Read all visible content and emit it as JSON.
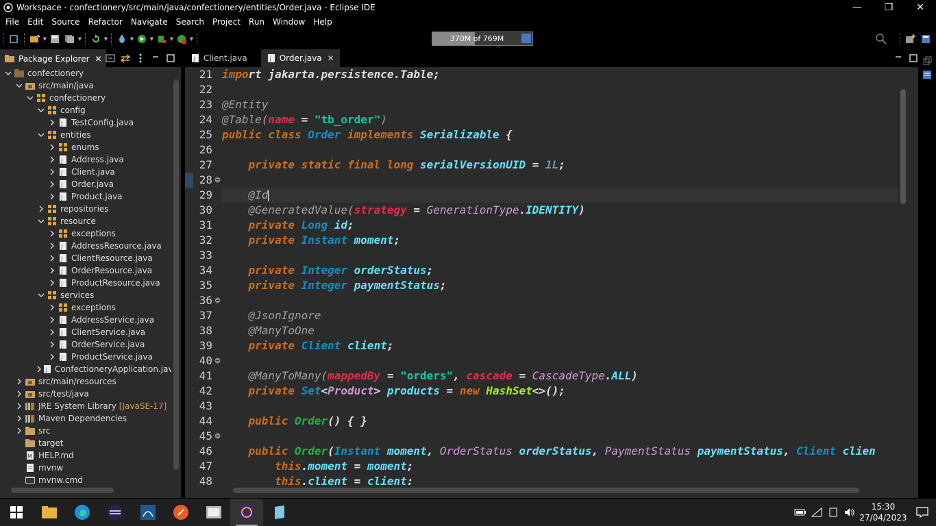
{
  "window": {
    "title": "Workspace - confectionery/src/main/java/confectionery/entities/Order.java - Eclipse IDE",
    "minimize": "—",
    "restore": "❐",
    "close": "✕"
  },
  "menubar": [
    "File",
    "Edit",
    "Source",
    "Refactor",
    "Navigate",
    "Search",
    "Project",
    "Run",
    "Window",
    "Help"
  ],
  "heap": {
    "label": "370M of 769M",
    "used_fraction": 0.48
  },
  "package_explorer": {
    "tab_label": "Package Explorer",
    "close": "✕",
    "tree": [
      {
        "label": "confectionery",
        "depth": 0,
        "arrow": "open",
        "icon": "project-icon"
      },
      {
        "label": "src/main/java",
        "depth": 1,
        "arrow": "open",
        "icon": "source-folder-icon"
      },
      {
        "label": "confectionery",
        "depth": 2,
        "arrow": "open",
        "icon": "package-icon"
      },
      {
        "label": "config",
        "depth": 3,
        "arrow": "open",
        "icon": "package-icon"
      },
      {
        "label": "TestConfig.java",
        "depth": 4,
        "arrow": "closed",
        "icon": "java-file-icon"
      },
      {
        "label": "entities",
        "depth": 3,
        "arrow": "open",
        "icon": "package-icon"
      },
      {
        "label": "enums",
        "depth": 4,
        "arrow": "closed",
        "icon": "package-icon"
      },
      {
        "label": "Address.java",
        "depth": 4,
        "arrow": "closed",
        "icon": "java-file-icon"
      },
      {
        "label": "Client.java",
        "depth": 4,
        "arrow": "closed",
        "icon": "java-file-icon"
      },
      {
        "label": "Order.java",
        "depth": 4,
        "arrow": "closed",
        "icon": "java-file-icon"
      },
      {
        "label": "Product.java",
        "depth": 4,
        "arrow": "closed",
        "icon": "java-file-icon"
      },
      {
        "label": "repositories",
        "depth": 3,
        "arrow": "closed",
        "icon": "package-icon"
      },
      {
        "label": "resource",
        "depth": 3,
        "arrow": "open",
        "icon": "package-icon"
      },
      {
        "label": "exceptions",
        "depth": 4,
        "arrow": "closed",
        "icon": "package-icon"
      },
      {
        "label": "AddressResource.java",
        "depth": 4,
        "arrow": "closed",
        "icon": "java-file-icon"
      },
      {
        "label": "ClientResource.java",
        "depth": 4,
        "arrow": "closed",
        "icon": "java-file-icon"
      },
      {
        "label": "OrderResource.java",
        "depth": 4,
        "arrow": "closed",
        "icon": "java-file-icon"
      },
      {
        "label": "ProductResource.java",
        "depth": 4,
        "arrow": "closed",
        "icon": "java-file-icon"
      },
      {
        "label": "services",
        "depth": 3,
        "arrow": "open",
        "icon": "package-icon"
      },
      {
        "label": "exceptions",
        "depth": 4,
        "arrow": "closed",
        "icon": "package-icon"
      },
      {
        "label": "AddressService.java",
        "depth": 4,
        "arrow": "closed",
        "icon": "java-file-icon"
      },
      {
        "label": "ClientService.java",
        "depth": 4,
        "arrow": "closed",
        "icon": "java-file-icon"
      },
      {
        "label": "OrderService.java",
        "depth": 4,
        "arrow": "closed",
        "icon": "java-file-icon"
      },
      {
        "label": "ProductService.java",
        "depth": 4,
        "arrow": "closed",
        "icon": "java-file-icon"
      },
      {
        "label": "ConfectioneryApplication.java",
        "depth": 3,
        "arrow": "closed",
        "icon": "java-file-icon"
      },
      {
        "label": "src/main/resources",
        "depth": 1,
        "arrow": "closed",
        "icon": "source-folder-icon"
      },
      {
        "label": "src/test/java",
        "depth": 1,
        "arrow": "closed",
        "icon": "source-folder-icon"
      },
      {
        "label": "JRE System Library",
        "decoration": "[JavaSE-17]",
        "depth": 1,
        "arrow": "closed",
        "icon": "library-icon"
      },
      {
        "label": "Maven Dependencies",
        "depth": 1,
        "arrow": "closed",
        "icon": "library-icon"
      },
      {
        "label": "src",
        "depth": 1,
        "arrow": "closed",
        "icon": "folder-icon"
      },
      {
        "label": "target",
        "depth": 1,
        "arrow": "none",
        "icon": "folder-icon"
      },
      {
        "label": "HELP.md",
        "depth": 1,
        "arrow": "none",
        "icon": "markdown-file-icon"
      },
      {
        "label": "mvnw",
        "depth": 1,
        "arrow": "none",
        "icon": "text-file-icon"
      },
      {
        "label": "mvnw.cmd",
        "depth": 1,
        "arrow": "none",
        "icon": "cmd-file-icon"
      }
    ]
  },
  "editor": {
    "tabs": [
      {
        "label": "Client.java",
        "active": false
      },
      {
        "label": "Order.java",
        "active": true
      }
    ],
    "tab_close": "✕",
    "line_numbers": [
      "21",
      "22",
      "23",
      "24",
      "25",
      "26",
      "27",
      "28",
      "29",
      "30",
      "31",
      "32",
      "33",
      "34",
      "35",
      "36",
      "37",
      "38",
      "39",
      "40",
      "41",
      "42",
      "43",
      "44",
      "45",
      "46",
      "47",
      "48"
    ],
    "fold_lines": [
      "28",
      "36",
      "40",
      "45"
    ],
    "current_line": "28"
  },
  "taskbar": {
    "apps": [
      "start-icon",
      "file-explorer-icon",
      "edge-icon",
      "eclipse-icon",
      "mysql-workbench-icon",
      "postman-icon",
      "snipping-tool-icon",
      "eclipse-ide-active-icon",
      "notepad-icon"
    ],
    "time": "15:30",
    "date": "27/04/2023"
  }
}
